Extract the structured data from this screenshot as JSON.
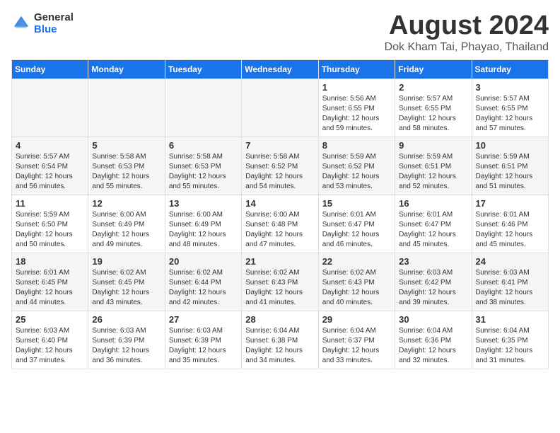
{
  "header": {
    "logo_line1": "General",
    "logo_line2": "Blue",
    "month_year": "August 2024",
    "location": "Dok Kham Tai, Phayao, Thailand"
  },
  "days_of_week": [
    "Sunday",
    "Monday",
    "Tuesday",
    "Wednesday",
    "Thursday",
    "Friday",
    "Saturday"
  ],
  "weeks": [
    [
      {
        "day": "",
        "info": ""
      },
      {
        "day": "",
        "info": ""
      },
      {
        "day": "",
        "info": ""
      },
      {
        "day": "",
        "info": ""
      },
      {
        "day": "1",
        "info": "Sunrise: 5:56 AM\nSunset: 6:55 PM\nDaylight: 12 hours\nand 59 minutes."
      },
      {
        "day": "2",
        "info": "Sunrise: 5:57 AM\nSunset: 6:55 PM\nDaylight: 12 hours\nand 58 minutes."
      },
      {
        "day": "3",
        "info": "Sunrise: 5:57 AM\nSunset: 6:55 PM\nDaylight: 12 hours\nand 57 minutes."
      }
    ],
    [
      {
        "day": "4",
        "info": "Sunrise: 5:57 AM\nSunset: 6:54 PM\nDaylight: 12 hours\nand 56 minutes."
      },
      {
        "day": "5",
        "info": "Sunrise: 5:58 AM\nSunset: 6:53 PM\nDaylight: 12 hours\nand 55 minutes."
      },
      {
        "day": "6",
        "info": "Sunrise: 5:58 AM\nSunset: 6:53 PM\nDaylight: 12 hours\nand 55 minutes."
      },
      {
        "day": "7",
        "info": "Sunrise: 5:58 AM\nSunset: 6:52 PM\nDaylight: 12 hours\nand 54 minutes."
      },
      {
        "day": "8",
        "info": "Sunrise: 5:59 AM\nSunset: 6:52 PM\nDaylight: 12 hours\nand 53 minutes."
      },
      {
        "day": "9",
        "info": "Sunrise: 5:59 AM\nSunset: 6:51 PM\nDaylight: 12 hours\nand 52 minutes."
      },
      {
        "day": "10",
        "info": "Sunrise: 5:59 AM\nSunset: 6:51 PM\nDaylight: 12 hours\nand 51 minutes."
      }
    ],
    [
      {
        "day": "11",
        "info": "Sunrise: 5:59 AM\nSunset: 6:50 PM\nDaylight: 12 hours\nand 50 minutes."
      },
      {
        "day": "12",
        "info": "Sunrise: 6:00 AM\nSunset: 6:49 PM\nDaylight: 12 hours\nand 49 minutes."
      },
      {
        "day": "13",
        "info": "Sunrise: 6:00 AM\nSunset: 6:49 PM\nDaylight: 12 hours\nand 48 minutes."
      },
      {
        "day": "14",
        "info": "Sunrise: 6:00 AM\nSunset: 6:48 PM\nDaylight: 12 hours\nand 47 minutes."
      },
      {
        "day": "15",
        "info": "Sunrise: 6:01 AM\nSunset: 6:47 PM\nDaylight: 12 hours\nand 46 minutes."
      },
      {
        "day": "16",
        "info": "Sunrise: 6:01 AM\nSunset: 6:47 PM\nDaylight: 12 hours\nand 45 minutes."
      },
      {
        "day": "17",
        "info": "Sunrise: 6:01 AM\nSunset: 6:46 PM\nDaylight: 12 hours\nand 45 minutes."
      }
    ],
    [
      {
        "day": "18",
        "info": "Sunrise: 6:01 AM\nSunset: 6:45 PM\nDaylight: 12 hours\nand 44 minutes."
      },
      {
        "day": "19",
        "info": "Sunrise: 6:02 AM\nSunset: 6:45 PM\nDaylight: 12 hours\nand 43 minutes."
      },
      {
        "day": "20",
        "info": "Sunrise: 6:02 AM\nSunset: 6:44 PM\nDaylight: 12 hours\nand 42 minutes."
      },
      {
        "day": "21",
        "info": "Sunrise: 6:02 AM\nSunset: 6:43 PM\nDaylight: 12 hours\nand 41 minutes."
      },
      {
        "day": "22",
        "info": "Sunrise: 6:02 AM\nSunset: 6:43 PM\nDaylight: 12 hours\nand 40 minutes."
      },
      {
        "day": "23",
        "info": "Sunrise: 6:03 AM\nSunset: 6:42 PM\nDaylight: 12 hours\nand 39 minutes."
      },
      {
        "day": "24",
        "info": "Sunrise: 6:03 AM\nSunset: 6:41 PM\nDaylight: 12 hours\nand 38 minutes."
      }
    ],
    [
      {
        "day": "25",
        "info": "Sunrise: 6:03 AM\nSunset: 6:40 PM\nDaylight: 12 hours\nand 37 minutes."
      },
      {
        "day": "26",
        "info": "Sunrise: 6:03 AM\nSunset: 6:39 PM\nDaylight: 12 hours\nand 36 minutes."
      },
      {
        "day": "27",
        "info": "Sunrise: 6:03 AM\nSunset: 6:39 PM\nDaylight: 12 hours\nand 35 minutes."
      },
      {
        "day": "28",
        "info": "Sunrise: 6:04 AM\nSunset: 6:38 PM\nDaylight: 12 hours\nand 34 minutes."
      },
      {
        "day": "29",
        "info": "Sunrise: 6:04 AM\nSunset: 6:37 PM\nDaylight: 12 hours\nand 33 minutes."
      },
      {
        "day": "30",
        "info": "Sunrise: 6:04 AM\nSunset: 6:36 PM\nDaylight: 12 hours\nand 32 minutes."
      },
      {
        "day": "31",
        "info": "Sunrise: 6:04 AM\nSunset: 6:35 PM\nDaylight: 12 hours\nand 31 minutes."
      }
    ]
  ]
}
